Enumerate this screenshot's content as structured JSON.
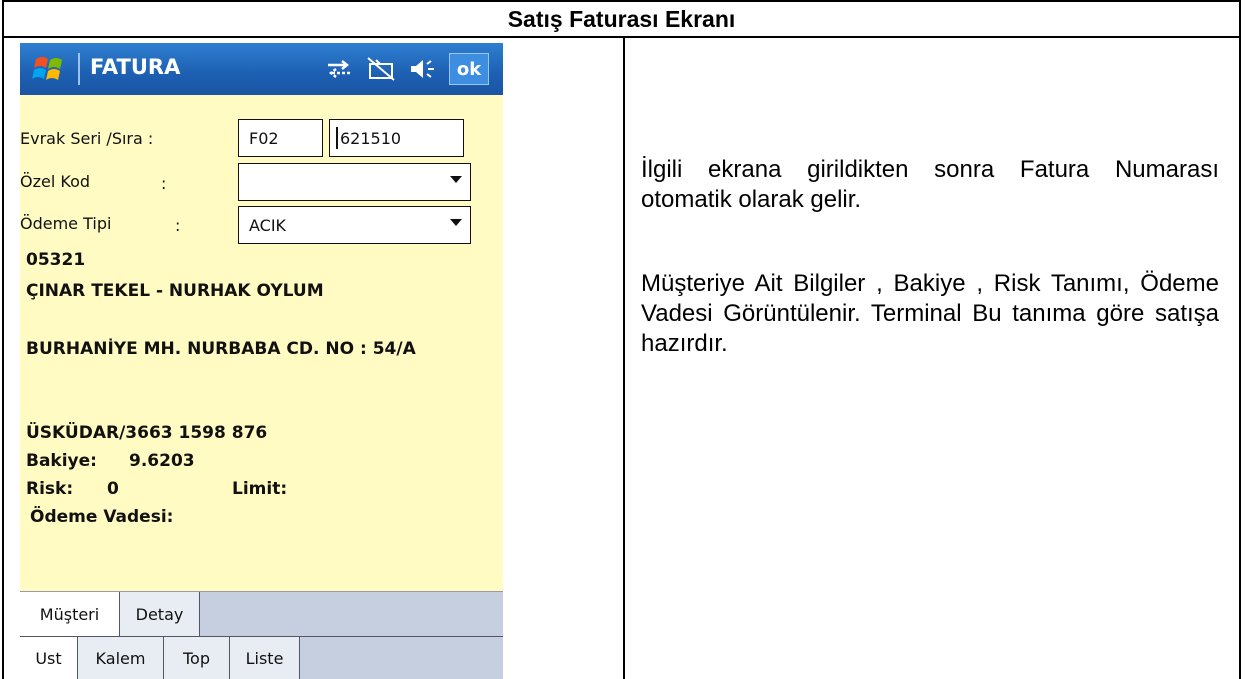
{
  "page_title": "Satış Faturası Ekranı",
  "device": {
    "app_title": "FATURA",
    "ok_label": "ok",
    "icons": [
      "sync-icon",
      "battery-icon",
      "speaker-icon"
    ],
    "form": {
      "evrak_label": "Evrak Seri /Sıra :",
      "evrak_seri": "F02",
      "evrak_sira": "621510",
      "ozel_kod_label": "Özel Kod",
      "ozel_kod_value": "",
      "odeme_tipi_label": "Ödeme Tipi",
      "odeme_tipi_value": "ACIK",
      "colon": ":"
    },
    "customer": {
      "code": "05321",
      "name": "ÇINAR TEKEL - NURHAK OYLUM",
      "address": "BURHANİYE MH. NURBABA CD. NO : 54/A",
      "city_phone": "ÜSKÜDAR/3663 1598 876",
      "bakiye_label": "Bakiye:",
      "bakiye_value": "9.6203",
      "risk_label": "Risk:",
      "risk_value": "0",
      "limit_label": "Limit:",
      "vade_label": "Ödeme Vadesi:"
    },
    "tabs_top": [
      "Müşteri",
      "Detay"
    ],
    "tabs_bottom": [
      "Ust",
      "Kalem",
      "Top",
      "Liste"
    ]
  },
  "description": {
    "para1": "İlgili ekrana girildikten sonra Fatura Numarası otomatik olarak gelir.",
    "para2": "Müşteriye Ait Bilgiler , Bakiye , Risk Tanımı, Ödeme Vadesi Görüntülenir. Terminal Bu tanıma göre satışa hazırdır."
  },
  "colors": {
    "screen_bg": "#fffbc2",
    "titlebar": "#1d5fb2",
    "tab_bg": "#c5cfdf"
  }
}
